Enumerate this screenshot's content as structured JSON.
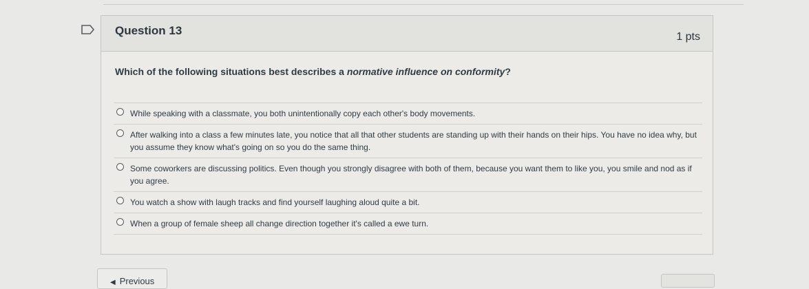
{
  "question": {
    "title": "Question 13",
    "points": "1 pts",
    "text_prefix": "Which of the following situations best describes a ",
    "text_emphasis": "normative influence on conformity",
    "text_suffix": "?"
  },
  "answers": [
    {
      "label": "While speaking with a classmate, you both unintentionally copy each other's body movements."
    },
    {
      "label": "After walking into a class a few minutes late, you notice that all that other students are standing up with their hands on their hips. You have no idea why, but you assume they know what's going on so you do the same thing."
    },
    {
      "label": "Some coworkers are discussing politics. Even though you strongly disagree with both of them, because you want them to like you, you smile and nod as if you agree."
    },
    {
      "label": "You watch a show with laugh tracks and find yourself laughing aloud quite a bit."
    },
    {
      "label": "When a group of female sheep all change direction together it's called a ewe turn."
    }
  ],
  "navigation": {
    "previous_label": "Previous"
  },
  "icons": {
    "flag": "flag-icon",
    "radio": "radio-button-icon",
    "chevron": "chevron-left-icon"
  },
  "colors": {
    "page_bg": "#e9e9e7",
    "text": "#2d3b45"
  }
}
